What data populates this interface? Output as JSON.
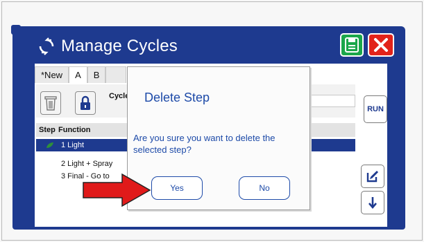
{
  "window": {
    "title": "Manage Cycles"
  },
  "icons": {
    "cycle": "refresh-icon",
    "save": "save-icon",
    "close": "close-icon",
    "delete": "trash-icon",
    "lock": "lock-icon",
    "edit": "edit-icon",
    "move_down": "arrow-down-icon"
  },
  "colors": {
    "panel": "#1e3a8f",
    "save": "#1aa64a",
    "close": "#e2231a",
    "selected_row": "#1e3a8f",
    "dialog_text": "#1d4aa8",
    "callout_arrow": "#e01a1a"
  },
  "tabs": [
    {
      "label": "*New"
    },
    {
      "label": "A"
    },
    {
      "label": "B"
    }
  ],
  "editor": {
    "cycle_label": "Cycle",
    "step_col": "Step",
    "function_col": "Function",
    "run_label": "RUN",
    "steps": [
      {
        "label": "1 Light",
        "selected": true
      },
      {
        "label": "2 Light + Spray",
        "selected": false
      },
      {
        "label": "3 Final - Go to",
        "selected": false
      }
    ]
  },
  "dialog": {
    "title": "Delete Step",
    "message": "Are you sure you want to delete the selected step?",
    "yes_label": "Yes",
    "no_label": "No"
  }
}
